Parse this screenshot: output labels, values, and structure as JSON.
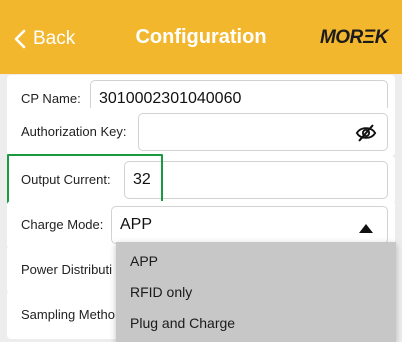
{
  "header": {
    "back_label": "Back",
    "title": "Configuration",
    "logo": "MORΞK",
    "background_color": "#f3b72e"
  },
  "form": {
    "cp_name": {
      "label": "CP Name:",
      "value": "3010002301040060"
    },
    "authorization_key": {
      "label": "Authorization Key:",
      "value": "",
      "icon": "eye-slash-icon"
    },
    "output_current": {
      "label": "Output Current:",
      "value": "32",
      "highlight_color": "#1a9a3e"
    },
    "charge_mode": {
      "label": "Charge Mode:",
      "value": "APP",
      "icon": "caret-up-icon"
    },
    "power_distribution": {
      "label": "Power Distributi"
    },
    "sampling_method": {
      "label": "Sampling Metho"
    }
  },
  "charge_mode_menu": {
    "options": [
      "APP",
      "RFID only",
      "Plug and Charge"
    ]
  }
}
